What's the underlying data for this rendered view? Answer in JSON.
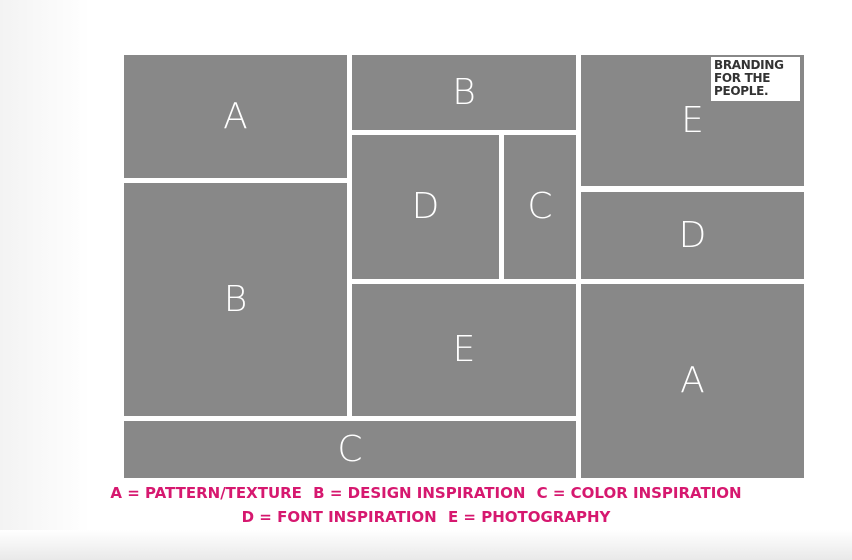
{
  "tiles": {
    "a_top_left": "A",
    "b_left": "B",
    "b_top_center": "B",
    "d_center": "D",
    "c_center": "C",
    "e_center": "E",
    "c_bottom": "C",
    "e_top_right": "E",
    "d_right": "D",
    "a_bottom_right": "A"
  },
  "logo": {
    "line1": "BRANDING",
    "line2": "FOR THE",
    "line3": "PEOPLE."
  },
  "legend": {
    "a": "A = PATTERN/TEXTURE",
    "b": "B = DESIGN INSPIRATION",
    "c": "C = COLOR INSPIRATION",
    "d": "D = FONT INSPIRATION",
    "e": "E = PHOTOGRAPHY"
  },
  "colors": {
    "tile": "#888888",
    "legend_text": "#d6186f",
    "background": "#ffffff"
  }
}
